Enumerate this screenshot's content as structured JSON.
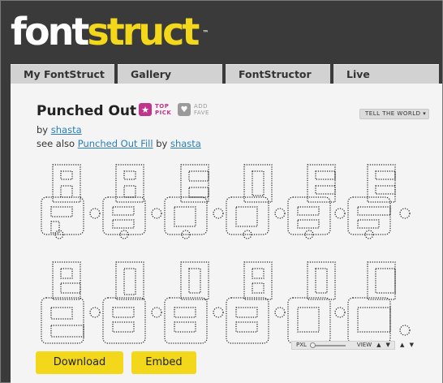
{
  "logo": {
    "text_white": "font",
    "text_yellow": "struct",
    "trademark": "™"
  },
  "tabs": [
    {
      "label": "My FontStruct"
    },
    {
      "label": "Gallery"
    },
    {
      "label": "FontStructor"
    },
    {
      "label": "Live"
    }
  ],
  "font": {
    "title": "Punched Out",
    "top_pick": {
      "line1": "TOP",
      "line2": "PICK"
    },
    "add_fave": {
      "line1": "ADD",
      "line2": "FAVE"
    },
    "tell_the_world": "TELL THE WORLD ▾",
    "by_label": "by",
    "author": "shasta",
    "see_also_label": "see also",
    "see_also_link": "Punched Out Fill",
    "see_also_by": "by",
    "see_also_author": "shasta"
  },
  "preview": {
    "zoom_label": "PXL",
    "view_label": "VIEW",
    "up_arrow": "▲",
    "down_arrow": "▼"
  },
  "actions": {
    "download": "Download",
    "embed": "Embed"
  },
  "colors": {
    "brand_yellow": "#f2d71b",
    "top_pick": "#c2338c",
    "link": "#2a7fb8"
  }
}
